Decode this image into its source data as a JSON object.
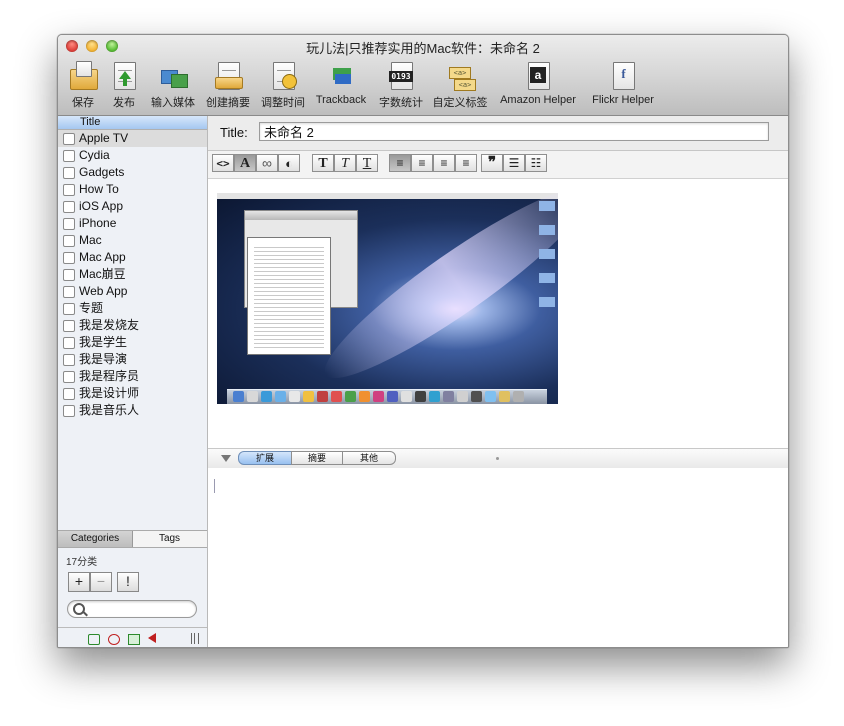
{
  "window": {
    "title": "玩儿法|只推荐实用的Mac软件：未命名 2"
  },
  "toolbar": {
    "items": [
      {
        "label": "保存",
        "icon": "save-icon"
      },
      {
        "label": "发布",
        "icon": "publish-icon"
      },
      {
        "label": "输入媒体",
        "icon": "import-media-icon"
      },
      {
        "label": "创建摘要",
        "icon": "create-excerpt-icon"
      },
      {
        "label": "调整时间",
        "icon": "adjust-time-icon"
      },
      {
        "label": "Trackback",
        "icon": "trackback-icon"
      },
      {
        "label": "字数统计",
        "icon": "word-count-icon"
      },
      {
        "label": "自定义标签",
        "icon": "custom-tags-icon"
      },
      {
        "label": "Amazon Helper",
        "icon": "amazon-icon"
      },
      {
        "label": "Flickr Helper",
        "icon": "flickr-icon"
      }
    ],
    "word_count_display": "0193",
    "tag_glyph": "<a>",
    "amazon_glyph": "a",
    "flickr_glyph": "f"
  },
  "sidebar": {
    "header": "Title",
    "categories": [
      "Apple TV",
      "Cydia",
      "Gadgets",
      "How To",
      "iOS App",
      "iPhone",
      "Mac",
      "Mac App",
      "Mac崩豆",
      "Web App",
      "专题",
      "我是发烧友",
      "我是学生",
      "我是导演",
      "我是程序员",
      "我是设计师",
      "我是音乐人"
    ],
    "selected_index": 0,
    "tabs": [
      "Categories",
      "Tags"
    ],
    "count_text": "17分类",
    "add_label": "+",
    "remove_label": "−",
    "alert_label": "!",
    "search_placeholder": ""
  },
  "editor": {
    "title_label": "Title:",
    "title_value": "未命名 2",
    "format_buttons": [
      "<>",
      "A",
      "∞",
      "◐",
      "T",
      "T",
      "T",
      "≡",
      "≡",
      "≡",
      "≡",
      "❞",
      "☰",
      "☷"
    ]
  },
  "bottom_tabs": [
    "扩展",
    "摘要",
    "其他"
  ],
  "colors": {
    "accent": "#98c0f0",
    "selected_row": "#dcdcdc"
  }
}
